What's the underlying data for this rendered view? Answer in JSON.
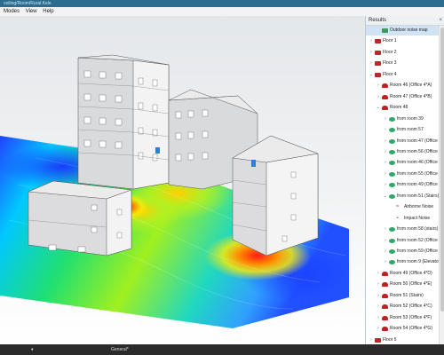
{
  "window": {
    "title": "ceiling/Room/Rural.Kele"
  },
  "menu": [
    "Modes",
    "View",
    "Help"
  ],
  "results": {
    "title": "Results",
    "close": "×",
    "rows": [
      {
        "label": "Outdoor noise map",
        "icon": "map",
        "level": 1,
        "arrow": "",
        "selected": true
      },
      {
        "label": "Floor 1",
        "icon": "floor",
        "level": 0,
        "arrow": "›"
      },
      {
        "label": "Floor 2",
        "icon": "floor",
        "level": 0,
        "arrow": "›"
      },
      {
        "label": "Floor 3",
        "icon": "floor",
        "level": 0,
        "arrow": "›"
      },
      {
        "label": "Floor 4",
        "icon": "floor",
        "level": 0,
        "arrow": "⌄"
      },
      {
        "label": "Room 46 (Office 4*A)",
        "icon": "room",
        "level": 1,
        "arrow": "›"
      },
      {
        "label": "Room 47 (Office 4*B)",
        "icon": "room",
        "level": 1,
        "arrow": "›"
      },
      {
        "label": "Room 48",
        "icon": "room",
        "level": 1,
        "arrow": "⌄"
      },
      {
        "label": "from room 39",
        "icon": "src",
        "level": 2,
        "arrow": "›"
      },
      {
        "label": "from room 57",
        "icon": "src",
        "level": 2,
        "arrow": "›"
      },
      {
        "label": "from room 47 (Office 4",
        "icon": "src",
        "level": 2,
        "arrow": "›"
      },
      {
        "label": "from room 56 (Office 5",
        "icon": "src",
        "level": 2,
        "arrow": "›"
      },
      {
        "label": "from room 46 (Office 4",
        "icon": "src",
        "level": 2,
        "arrow": "›"
      },
      {
        "label": "from room 55 (Office 5",
        "icon": "src",
        "level": 2,
        "arrow": "›"
      },
      {
        "label": "from room 49 (Office 4",
        "icon": "src",
        "level": 2,
        "arrow": "›"
      },
      {
        "label": "from room 51 (Stairs)",
        "icon": "src",
        "level": 2,
        "arrow": "⌄"
      },
      {
        "label": "Airborne Noise",
        "icon": "snd",
        "level": 3,
        "arrow": ""
      },
      {
        "label": "Impact Noise",
        "icon": "snd",
        "level": 3,
        "arrow": ""
      },
      {
        "label": "from room 58 (stairs)",
        "icon": "src",
        "level": 2,
        "arrow": "›"
      },
      {
        "label": "from room 52 (Office 4",
        "icon": "src",
        "level": 2,
        "arrow": "›"
      },
      {
        "label": "from room 59 (Office 5",
        "icon": "src",
        "level": 2,
        "arrow": "›"
      },
      {
        "label": "from room 9 (Elevator)",
        "icon": "src",
        "level": 2,
        "arrow": "›"
      },
      {
        "label": "Room 49 (Office 4*D)",
        "icon": "room",
        "level": 1,
        "arrow": "›"
      },
      {
        "label": "Room 50 (Office 4*E)",
        "icon": "room",
        "level": 1,
        "arrow": "›"
      },
      {
        "label": "Room 51 (Stairs)",
        "icon": "room",
        "level": 1,
        "arrow": "›"
      },
      {
        "label": "Room 52 (Office 4*C)",
        "icon": "room",
        "level": 1,
        "arrow": "›"
      },
      {
        "label": "Room 53 (Office 4*F)",
        "icon": "room",
        "level": 1,
        "arrow": "›"
      },
      {
        "label": "Room 54 (Office 4*G)",
        "icon": "room",
        "level": 1,
        "arrow": "›"
      },
      {
        "label": "Floor 5",
        "icon": "floor",
        "level": 0,
        "arrow": "›"
      }
    ]
  },
  "status": {
    "left": "",
    "mid": "General*"
  },
  "colors": {
    "titlebar": "#2a6d8f",
    "selection": "#cfe3f5",
    "floor_icon": "#b52a2a",
    "room_icon": "#c02020",
    "source_icon": "#2fa86a"
  },
  "noise_map": {
    "scale": [
      "blue",
      "cyan",
      "green",
      "yellow",
      "orange",
      "red"
    ]
  }
}
